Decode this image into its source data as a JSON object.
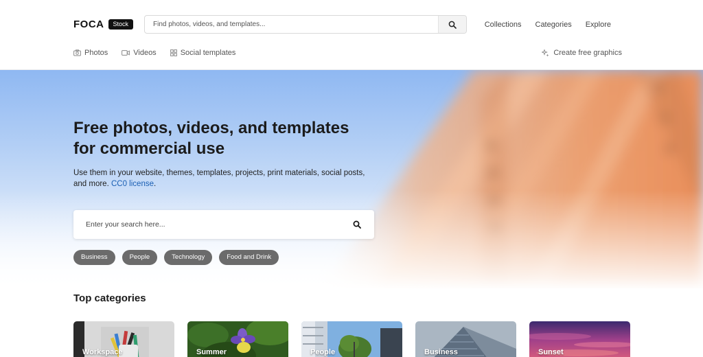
{
  "brand": {
    "name": "FOCA",
    "badge": "Stock"
  },
  "header_search": {
    "placeholder": "Find photos, videos, and templates..."
  },
  "top_nav": [
    "Collections",
    "Categories",
    "Explore"
  ],
  "sub_nav": [
    {
      "label": "Photos",
      "icon": "camera-icon"
    },
    {
      "label": "Videos",
      "icon": "video-icon"
    },
    {
      "label": "Social templates",
      "icon": "grid-icon"
    }
  ],
  "create_link": {
    "label": "Create free graphics",
    "icon": "sparkle-icon"
  },
  "hero": {
    "title_line1": "Free photos, videos, and templates",
    "title_line2": "for commercial use",
    "subtitle_line1": "Use them in your website, themes, templates, projects, print materials, social posts,",
    "subtitle_line2_prefix": "and more.",
    "license_link": "CC0 license",
    "subtitle_suffix": ".",
    "search_placeholder": "Enter your search here...",
    "chips": [
      "Business",
      "People",
      "Technology",
      "Food and Drink"
    ]
  },
  "categories": {
    "heading": "Top categories",
    "items": [
      "Workspace",
      "Summer",
      "People",
      "Business",
      "Sunset"
    ]
  },
  "colors": {
    "hero_sky": "#8fb8f2",
    "hero_accent_orange": "#f0a070",
    "chip_bg": "#6b6b6b",
    "link": "#1a5fb4"
  }
}
